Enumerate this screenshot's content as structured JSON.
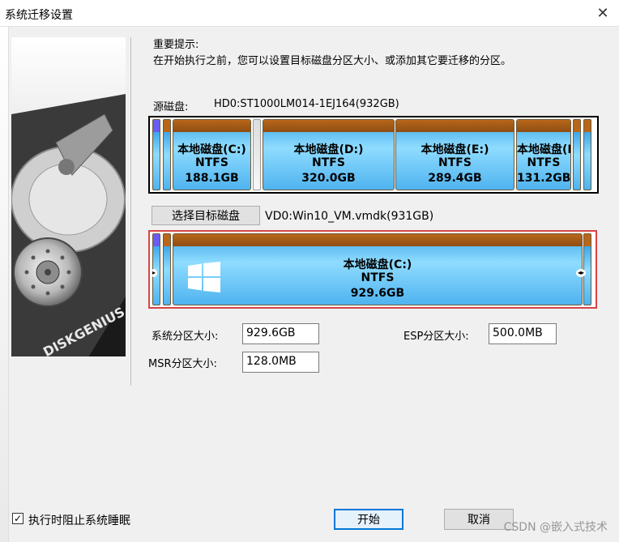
{
  "window": {
    "title": "系统迁移设置",
    "close_glyph": "✕"
  },
  "notice": {
    "title": "重要提示:",
    "text": "在开始执行之前，您可以设置目标磁盘分区大小、或添加其它要迁移的分区。"
  },
  "source": {
    "label": "源磁盘:",
    "disk": "HD0:ST1000LM014-1EJ164(932GB)",
    "partitions": [
      {
        "name": "本地磁盘(C:)",
        "fs": "NTFS",
        "size": "188.1GB"
      },
      {
        "name": "本地磁盘(D:)",
        "fs": "NTFS",
        "size": "320.0GB"
      },
      {
        "name": "本地磁盘(E:)",
        "fs": "NTFS",
        "size": "289.4GB"
      },
      {
        "name": "本地磁盘(F",
        "fs": "NTFS",
        "size": "131.2GB"
      }
    ]
  },
  "target": {
    "select_button": "选择目标磁盘",
    "disk": "VD0:Win10_VM.vmdk(931GB)",
    "partition": {
      "name": "本地磁盘(C:)",
      "fs": "NTFS",
      "size": "929.6GB"
    }
  },
  "fields": {
    "system_label": "系统分区大小:",
    "system_value": "929.6GB",
    "esp_label": "ESP分区大小:",
    "esp_value": "500.0MB",
    "msr_label": "MSR分区大小:",
    "msr_value": "128.0MB"
  },
  "footer": {
    "prevent_sleep_label": "执行时阻止系统睡眠",
    "prevent_sleep_checked": true,
    "start_button": "开始",
    "cancel_button": "取消"
  },
  "brand_text": "DISKGENIUS",
  "watermark": "CSDN @嵌入式技术"
}
